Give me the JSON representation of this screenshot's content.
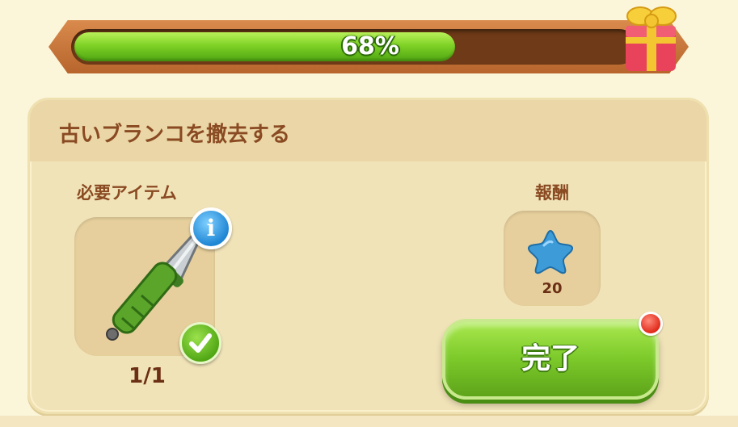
{
  "progress": {
    "percent": 68,
    "label": "68%"
  },
  "task": {
    "title": "古いブランコを撤去する",
    "required": {
      "label": "必要アイテム",
      "item_icon": "knife-icon",
      "count": "1/1"
    },
    "reward": {
      "label": "報酬",
      "icon": "blue-star-icon",
      "amount": "20"
    },
    "complete_label": "完了"
  },
  "colors": {
    "progress_fill": "#7fd225",
    "button_green": "#7cc92a",
    "panel": "#f1e3b8",
    "text_brown": "#8a4a22",
    "notify_red": "#e02a1a",
    "info_blue": "#1f86d4"
  }
}
